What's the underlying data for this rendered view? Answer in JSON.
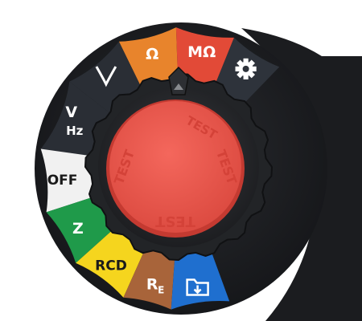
{
  "device": {
    "name": "rotary-function-dial"
  },
  "dial": {
    "segments": [
      {
        "id": "settings",
        "label": "",
        "icon": "gear-icon",
        "color": "#2e333b",
        "text_color": "#ffffff"
      },
      {
        "id": "megohm",
        "label": "MΩ",
        "icon": "",
        "color": "#e24a37",
        "text_color": "#ffffff"
      },
      {
        "id": "ohm",
        "label": "Ω",
        "icon": "",
        "color": "#e8842c",
        "text_color": "#ffffff"
      },
      {
        "id": "clamp",
        "label": "",
        "icon": "clamp-icon",
        "color": "#2a2e35",
        "text_color": "#ffffff"
      },
      {
        "id": "volt-hz",
        "label": "V",
        "sub_label": "Hz",
        "icon": "",
        "color": "#2a2e35",
        "text_color": "#ffffff"
      },
      {
        "id": "off",
        "label": "OFF",
        "icon": "",
        "color": "#f1f1f1",
        "text_color": "#1b1b1b"
      },
      {
        "id": "loop-z",
        "label": "Z",
        "icon": "",
        "color": "#1f9a4a",
        "text_color": "#ffffff"
      },
      {
        "id": "rcd",
        "label": "RCD",
        "icon": "",
        "color": "#f5d51e",
        "text_color": "#1b1b1b"
      },
      {
        "id": "earth-re",
        "label": "R",
        "sub_label": "E",
        "icon": "",
        "color": "#a8643a",
        "text_color": "#ffffff"
      },
      {
        "id": "memory",
        "label": "",
        "icon": "folder-download-icon",
        "color": "#1f6fcf",
        "text_color": "#ffffff"
      }
    ],
    "test_button": {
      "label_top": "TEST",
      "label_bottom": "TEST",
      "label_left": "TEST",
      "label_right": "TEST",
      "color": "#ee5a4f"
    },
    "colors": {
      "body": "#1d1f22",
      "knob": "#2a2c2f",
      "knob_edge": "#15171a"
    }
  }
}
